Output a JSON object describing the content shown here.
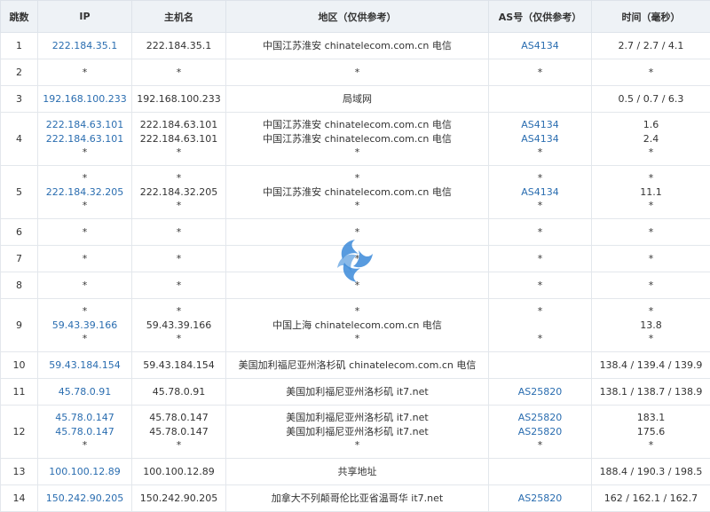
{
  "headers": {
    "hop": "跳数",
    "ip": "IP",
    "host": "主机名",
    "region": "地区（仅供参考）",
    "as": "AS号（仅供参考）",
    "time": "时间（毫秒）"
  },
  "rows": [
    {
      "hop": "1",
      "ip": [
        "222.184.35.1"
      ],
      "host": [
        "222.184.35.1"
      ],
      "region": [
        "中国江苏淮安 chinatelecom.com.cn 电信"
      ],
      "as": [
        "AS4134"
      ],
      "time": [
        "2.7 / 2.7 / 4.1"
      ]
    },
    {
      "hop": "2",
      "ip": [
        "*"
      ],
      "host": [
        "*"
      ],
      "region": [
        "*"
      ],
      "as": [
        "*"
      ],
      "time": [
        "*"
      ]
    },
    {
      "hop": "3",
      "ip": [
        "192.168.100.233"
      ],
      "host": [
        "192.168.100.233"
      ],
      "region": [
        "局域网"
      ],
      "as": [
        ""
      ],
      "time": [
        "0.5 / 0.7 / 6.3"
      ]
    },
    {
      "hop": "4",
      "ip": [
        "222.184.63.101",
        "222.184.63.101",
        "*"
      ],
      "host": [
        "222.184.63.101",
        "222.184.63.101",
        "*"
      ],
      "region": [
        "中国江苏淮安 chinatelecom.com.cn 电信",
        "中国江苏淮安 chinatelecom.com.cn 电信",
        "*"
      ],
      "as": [
        "AS4134",
        "AS4134",
        "*"
      ],
      "time": [
        "1.6",
        "2.4",
        "*"
      ]
    },
    {
      "hop": "5",
      "ip": [
        "*",
        "222.184.32.205",
        "*"
      ],
      "host": [
        "*",
        "222.184.32.205",
        "*"
      ],
      "region": [
        "*",
        "中国江苏淮安 chinatelecom.com.cn 电信",
        "*"
      ],
      "as": [
        "*",
        "AS4134",
        "*"
      ],
      "time": [
        "*",
        "11.1",
        "*"
      ]
    },
    {
      "hop": "6",
      "ip": [
        "*"
      ],
      "host": [
        "*"
      ],
      "region": [
        "*"
      ],
      "as": [
        "*"
      ],
      "time": [
        "*"
      ]
    },
    {
      "hop": "7",
      "ip": [
        "*"
      ],
      "host": [
        "*"
      ],
      "region": [
        "*"
      ],
      "as": [
        "*"
      ],
      "time": [
        "*"
      ]
    },
    {
      "hop": "8",
      "ip": [
        "*"
      ],
      "host": [
        "*"
      ],
      "region": [
        "*"
      ],
      "as": [
        "*"
      ],
      "time": [
        "*"
      ]
    },
    {
      "hop": "9",
      "ip": [
        "*",
        "59.43.39.166",
        "*"
      ],
      "host": [
        "*",
        "59.43.39.166",
        "*"
      ],
      "region": [
        "*",
        "中国上海 chinatelecom.com.cn 电信",
        "*"
      ],
      "as": [
        "*",
        "",
        "*"
      ],
      "time": [
        "*",
        "13.8",
        "*"
      ]
    },
    {
      "hop": "10",
      "ip": [
        "59.43.184.154"
      ],
      "host": [
        "59.43.184.154"
      ],
      "region": [
        "美国加利福尼亚州洛杉矶 chinatelecom.com.cn 电信"
      ],
      "as": [
        ""
      ],
      "time": [
        "138.4 / 139.4 / 139.9"
      ]
    },
    {
      "hop": "11",
      "ip": [
        "45.78.0.91"
      ],
      "host": [
        "45.78.0.91"
      ],
      "region": [
        "美国加利福尼亚州洛杉矶 it7.net"
      ],
      "as": [
        "AS25820"
      ],
      "time": [
        "138.1 / 138.7 / 138.9"
      ]
    },
    {
      "hop": "12",
      "ip": [
        "45.78.0.147",
        "45.78.0.147",
        "*"
      ],
      "host": [
        "45.78.0.147",
        "45.78.0.147",
        "*"
      ],
      "region": [
        "美国加利福尼亚州洛杉矶 it7.net",
        "美国加利福尼亚州洛杉矶 it7.net",
        "*"
      ],
      "as": [
        "AS25820",
        "AS25820",
        "*"
      ],
      "time": [
        "183.1",
        "175.6",
        "*"
      ]
    },
    {
      "hop": "13",
      "ip": [
        "100.100.12.89"
      ],
      "host": [
        "100.100.12.89"
      ],
      "region": [
        "共享地址"
      ],
      "as": [
        ""
      ],
      "time": [
        "188.4 / 190.3 / 198.5"
      ]
    },
    {
      "hop": "14",
      "ip": [
        "150.242.90.205"
      ],
      "host": [
        "150.242.90.205"
      ],
      "region": [
        "加拿大不列颠哥伦比亚省温哥华 it7.net"
      ],
      "as": [
        "AS25820"
      ],
      "time": [
        "162 / 162.1 / 162.7"
      ]
    }
  ],
  "colors": {
    "link": "#2a6db0",
    "header_bg": "#eef2f6",
    "watermark": "#3b8ad9"
  },
  "watermark_icon": "logo-icon"
}
